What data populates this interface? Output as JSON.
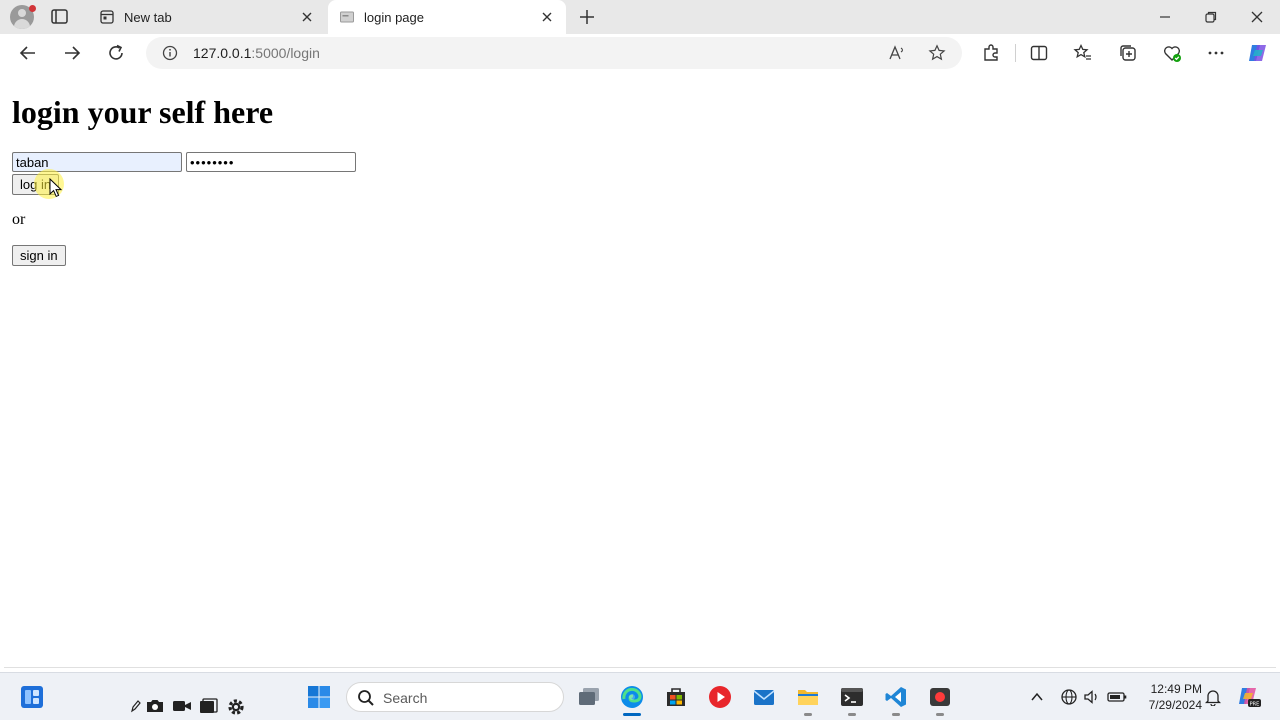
{
  "browser": {
    "tabs": [
      {
        "label": "New tab",
        "active": false
      },
      {
        "label": "login page",
        "active": true
      }
    ],
    "address": {
      "host": "127.0.0.1",
      "path": ":5000/login"
    },
    "colors": {
      "tabstrip": "#e8e8e8",
      "accent": "#0067c0"
    }
  },
  "page": {
    "title": "login your self here",
    "username_value": "taban",
    "password_value": "••••••••",
    "login_label": "log in",
    "or_text": "or",
    "signin_label": "sign in"
  },
  "taskbar": {
    "search_placeholder": "Search",
    "time": "12:49 PM",
    "date": "7/29/2024",
    "icons": [
      "start-icon",
      "search-icon",
      "task-view-icon",
      "edge-icon",
      "store-icon",
      "media-player-icon",
      "mail-icon",
      "file-explorer-icon",
      "terminal-icon",
      "vscode-icon",
      "recorder-icon"
    ]
  }
}
